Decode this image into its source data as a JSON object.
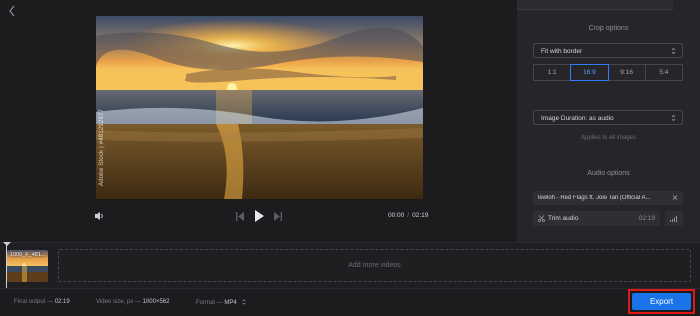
{
  "nav": {
    "back_icon": "chevron-left-icon"
  },
  "preview": {
    "watermark": "Adobe Stock | #481292977",
    "colors": {
      "sky_top": "#3f4f6a",
      "sun": "#ffd24a",
      "sea": "#2b3f55",
      "sand": "#5a3a16"
    }
  },
  "player": {
    "volume_icon": "speaker-icon",
    "prev_icon": "skip-previous-icon",
    "play_icon": "play-icon",
    "next_icon": "skip-next-icon",
    "current_time": "00:00",
    "separator": "/",
    "total_time": "02:19"
  },
  "panel": {
    "crop_title": "Crop options",
    "crop_mode": "Fit with border",
    "ratios": [
      "1:1",
      "16:9",
      "9:16",
      "5:4"
    ],
    "active_ratio": "16:9",
    "duration": "Image Duration: as audio",
    "applies": "Applies to all images",
    "audio_title": "Audio options",
    "audio_file": "lewloh - Red Flags ft. Jole Tan (Official A...",
    "trim_label": "Trim audio",
    "trim_duration": "02:19"
  },
  "timeline": {
    "clip_label": "1000_F_481...",
    "add_more": "Add more videos"
  },
  "bottom": {
    "final_output_label": "Final output —",
    "final_output_value": "02:19",
    "video_size_label": "Video size, px —",
    "video_size_value": "1000×562",
    "format_label": "Format —",
    "format_value": "MP4",
    "export_label": "Export"
  },
  "colors": {
    "accent": "#1a73e8",
    "highlight": "#e01818",
    "panel": "#26262a"
  }
}
